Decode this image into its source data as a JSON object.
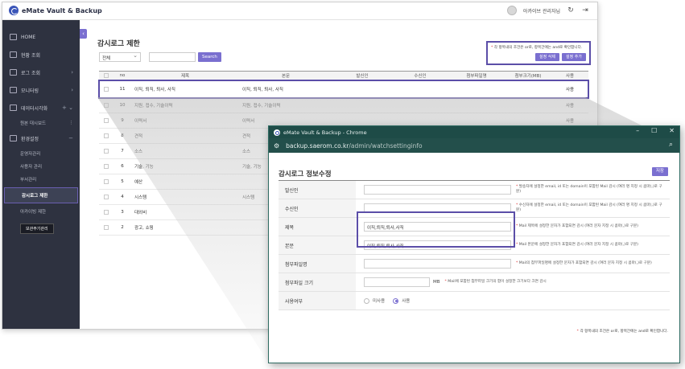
{
  "app": {
    "brand": "eMate Vault & Backup",
    "user_name": "아카이브 관리자님",
    "sidebar": {
      "items": [
        {
          "label": "HOME",
          "arrow": ""
        },
        {
          "label": "현황 조회",
          "arrow": ""
        },
        {
          "label": "로그 조회",
          "arrow": "›"
        },
        {
          "label": "모니터링",
          "arrow": "›"
        },
        {
          "label": "데이터시각화",
          "arrow": "+ ⌄"
        }
      ],
      "dashboard_label": "원본 대시보드",
      "settings_label": "환경설정",
      "sub_items": [
        "운영자관리",
        "사용자 관리",
        "부서관리",
        "감시로그 제한",
        "아카이빙 제한"
      ],
      "tooltip": "보관주기관리"
    },
    "page_title": "감시로그 제한",
    "filter": {
      "select_value": "전체",
      "search_button": "Search"
    },
    "notice": {
      "text_prefix": "* ",
      "text": "각 항목내의 조건은 or로, 항목간에는 and로 확인합니다.",
      "buttons": [
        "설정 삭제",
        "설정 추가"
      ]
    },
    "table": {
      "headers": [
        "no",
        "제목",
        "본문",
        "발신인",
        "수신인",
        "첨부파일명",
        "첨부크기(MB)",
        "사용"
      ],
      "rows": [
        {
          "no": "11",
          "title": "이직, 퇴직, 퇴사, 사직",
          "body": "이직, 퇴직, 퇴사, 사직",
          "use": "사용"
        },
        {
          "no": "10",
          "title": "지원, 접수, 기술이력",
          "body": "지원, 접수, 기술이력",
          "use": "사용"
        },
        {
          "no": "9",
          "title": "이력서",
          "body": "이력서",
          "use": "사용"
        },
        {
          "no": "8",
          "title": "견적",
          "body": "견적",
          "use": ""
        },
        {
          "no": "7",
          "title": "소스",
          "body": "소스",
          "use": ""
        },
        {
          "no": "6",
          "title": "기술, 기능",
          "body": "기술, 기능",
          "use": ""
        },
        {
          "no": "5",
          "title": "예산",
          "body": "",
          "use": ""
        },
        {
          "no": "4",
          "title": "시스템",
          "body": "시스템",
          "use": ""
        },
        {
          "no": "3",
          "title": "대외비",
          "body": "",
          "use": ""
        },
        {
          "no": "2",
          "title": "광고, 쇼핑",
          "body": "",
          "use": ""
        }
      ]
    }
  },
  "browser": {
    "window_title": "eMate Vault & Backup - Chrome",
    "url_host": "backup.saerom.co.kr",
    "url_path": "/admin/watchsettinginfo",
    "form_title": "감시로그 정보수정",
    "save_button": "저장",
    "fields": [
      {
        "label": "발신인",
        "value": "",
        "hint": "발송자에 설정한 email, id 또는 domain이 포함된 Mail 감시 (여러 명 지정 시 콤마(,)로 구분)"
      },
      {
        "label": "수신인",
        "value": "",
        "hint": "수신자에 설정한 email, id 또는 domain이 포함된 Mail 감시 (여러 명 지정 시 콤마(,)로 구분)"
      },
      {
        "label": "제목",
        "value": "이직,퇴직,퇴사,사직",
        "hint": "Mail 제목에 설정한 문자가 포함되면 감시 (여러 문자 지정 시 콤마(,)로 구분)"
      },
      {
        "label": "본문",
        "value": "이직,퇴직,퇴사,사직",
        "hint": "Mail 본문에 설정한 문자가 포함되면 감시 (여러 문자 지정 시 콤마(,)로 구분)"
      },
      {
        "label": "첨부파일명",
        "value": "",
        "hint": "Mail의 첨부파일명에 설정한 문자가 포함되면 감시 (여러 문자 지정 시 콤마(,)로 구분)"
      },
      {
        "label": "첨부파일 크기",
        "value": "",
        "unit": "MB",
        "hint": "Mail에 포함된 첨부파일 크기의 합이 설정한 크기보다 크면 감시"
      }
    ],
    "usage": {
      "label": "사용여부",
      "options": [
        "미사용",
        "사용"
      ],
      "selected": "사용"
    },
    "foot_note": "각 항목내의 조건은 or로, 항목간에는 and로 확인합니다."
  },
  "colors": {
    "accent": "#7a6fd0",
    "highlight": "#5b4ea8",
    "sidebar": "#2e3240",
    "browser_bar": "#1e4b47"
  }
}
